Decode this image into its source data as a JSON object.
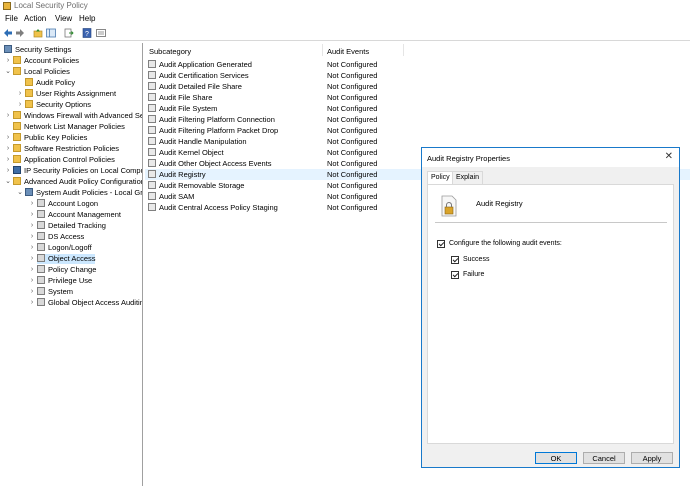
{
  "window": {
    "title": "Local Security Policy"
  },
  "menu": {
    "file": "File",
    "action": "Action",
    "view": "View",
    "help": "Help"
  },
  "toolbar": {
    "icons": [
      "back-arrow-icon",
      "forward-arrow-icon",
      "up-folder-icon",
      "show-tree-icon",
      "export-list-icon",
      "help-icon",
      "properties-icon"
    ]
  },
  "tree": {
    "items": [
      {
        "label": "Security Settings"
      },
      {
        "label": "Account Policies"
      },
      {
        "label": "Local Policies"
      },
      {
        "label": "Audit Policy"
      },
      {
        "label": "User Rights Assignment"
      },
      {
        "label": "Security Options"
      },
      {
        "label": "Windows Firewall with Advanced Secu"
      },
      {
        "label": "Network List Manager Policies"
      },
      {
        "label": "Public Key Policies"
      },
      {
        "label": "Software Restriction Policies"
      },
      {
        "label": "Application Control Policies"
      },
      {
        "label": "IP Security Policies on Local Compute"
      },
      {
        "label": "Advanced Audit Policy Configuration"
      },
      {
        "label": "System Audit Policies - Local Grou"
      },
      {
        "label": "Account Logon"
      },
      {
        "label": "Account Management"
      },
      {
        "label": "Detailed Tracking"
      },
      {
        "label": "DS Access"
      },
      {
        "label": "Logon/Logoff"
      },
      {
        "label": "Object Access"
      },
      {
        "label": "Policy Change"
      },
      {
        "label": "Privilege Use"
      },
      {
        "label": "System"
      },
      {
        "label": "Global Object Access Auditing"
      }
    ]
  },
  "list": {
    "columns": {
      "subcategory": "Subcategory",
      "audit_events": "Audit Events"
    },
    "rows": [
      {
        "name": "Audit Application Generated",
        "value": "Not Configured"
      },
      {
        "name": "Audit Certification Services",
        "value": "Not Configured"
      },
      {
        "name": "Audit Detailed File Share",
        "value": "Not Configured"
      },
      {
        "name": "Audit File Share",
        "value": "Not Configured"
      },
      {
        "name": "Audit File System",
        "value": "Not Configured"
      },
      {
        "name": "Audit Filtering Platform Connection",
        "value": "Not Configured"
      },
      {
        "name": "Audit Filtering Platform Packet Drop",
        "value": "Not Configured"
      },
      {
        "name": "Audit Handle Manipulation",
        "value": "Not Configured"
      },
      {
        "name": "Audit Kernel Object",
        "value": "Not Configured"
      },
      {
        "name": "Audit Other Object Access Events",
        "value": "Not Configured"
      },
      {
        "name": "Audit Registry",
        "value": "Not Configured"
      },
      {
        "name": "Audit Removable Storage",
        "value": "Not Configured"
      },
      {
        "name": "Audit SAM",
        "value": "Not Configured"
      },
      {
        "name": "Audit Central Access Policy Staging",
        "value": "Not Configured"
      }
    ]
  },
  "dialog": {
    "title": "Audit Registry Properties",
    "tabs": {
      "policy": "Policy",
      "explain": "Explain"
    },
    "policy_name": "Audit Registry",
    "configure_label": "Configure the following audit events:",
    "success_label": "Success",
    "failure_label": "Failure",
    "buttons": {
      "ok": "OK",
      "cancel": "Cancel",
      "apply": "Apply"
    }
  },
  "colors": {
    "accent": "#1979ca",
    "selection": "#cce8ff",
    "folder": "#f0c24b"
  }
}
